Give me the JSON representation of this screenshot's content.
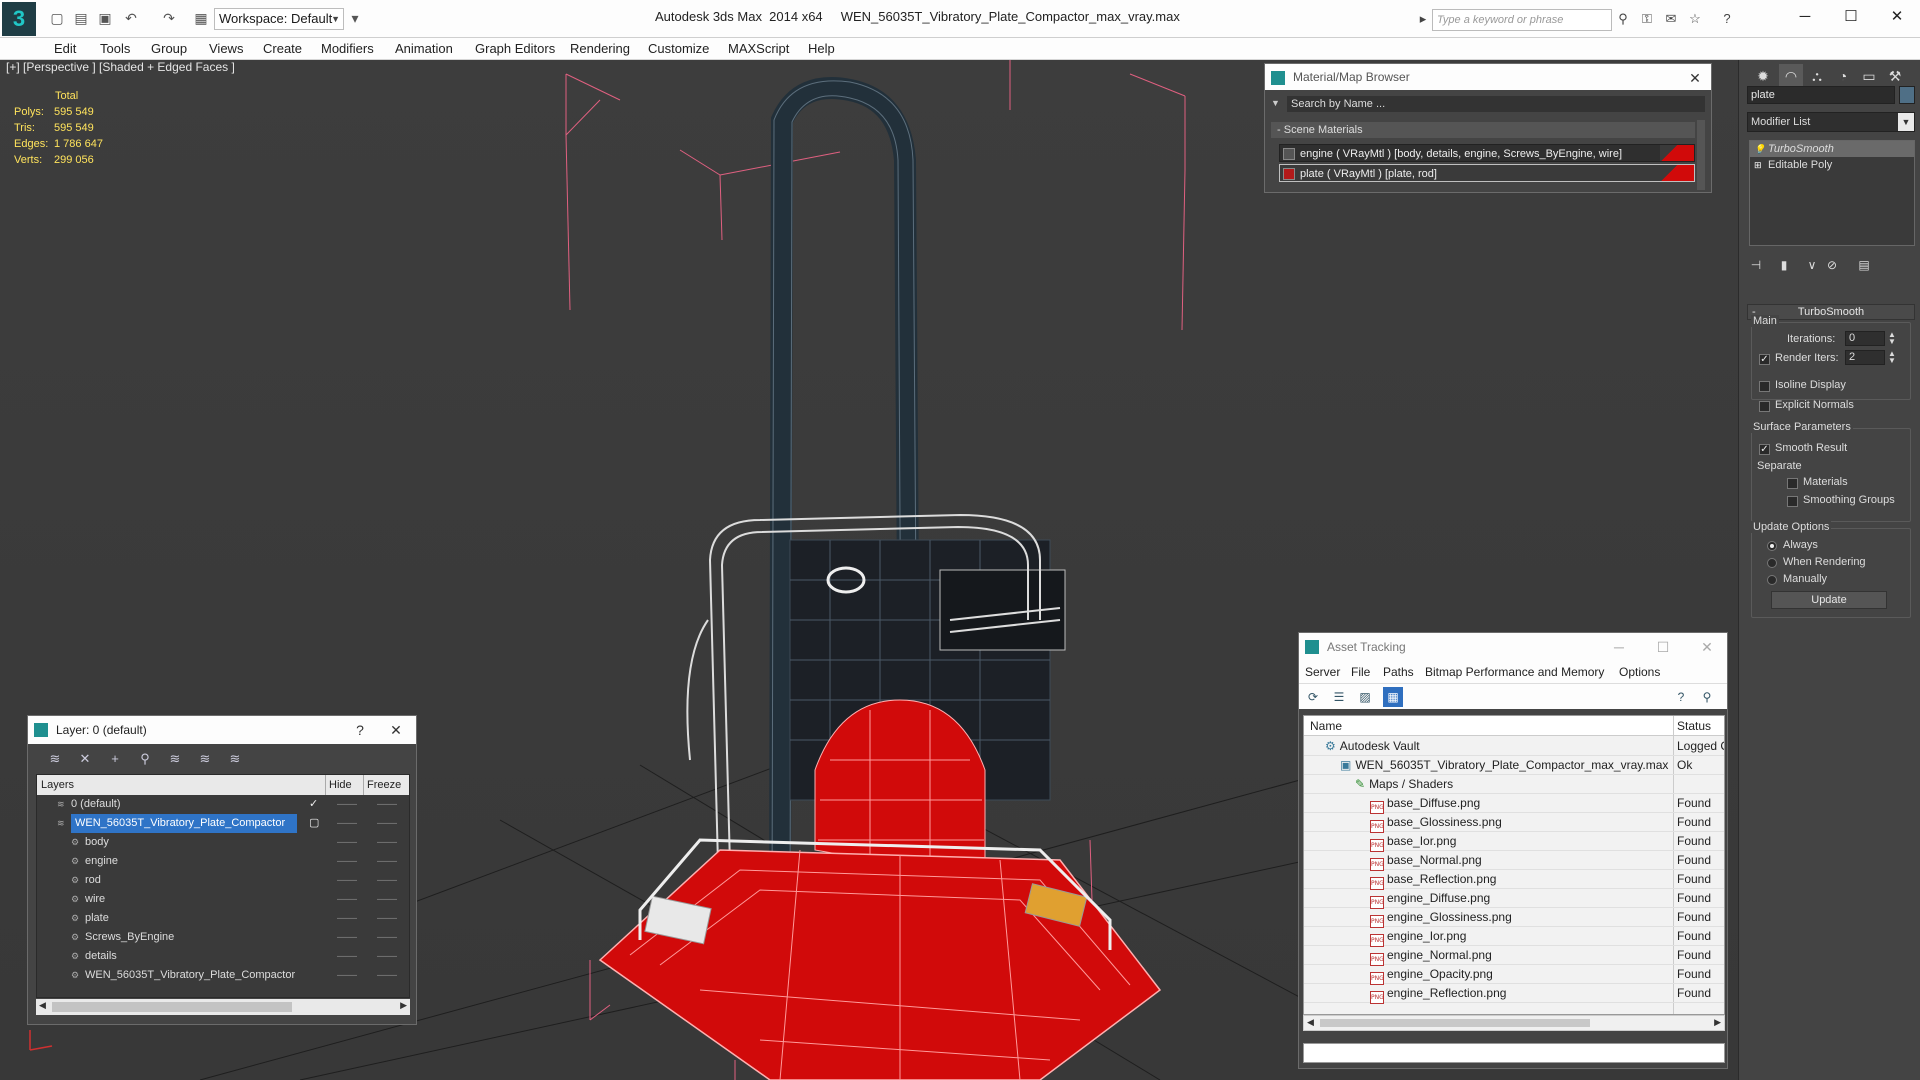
{
  "app": {
    "title": "Autodesk 3ds Max  2014 x64     WEN_56035T_Vibratory_Plate_Compactor_max_vray.max",
    "workspace": "Workspace: Default",
    "search_placeholder": "Type a keyword or phrase"
  },
  "menu": [
    "Edit",
    "Tools",
    "Group",
    "Views",
    "Create",
    "Modifiers",
    "Animation",
    "Graph Editors",
    "Rendering",
    "Customize",
    "MAXScript",
    "Help"
  ],
  "viewport": {
    "label": "[+] [Perspective ] [Shaded + Edged Faces ]",
    "stats_header": "Total",
    "stats": [
      {
        "label": "Polys:",
        "value": "595 549"
      },
      {
        "label": "Tris:",
        "value": "595 549"
      },
      {
        "label": "Edges:",
        "value": "1 786 647"
      },
      {
        "label": "Verts:",
        "value": "299 056"
      }
    ]
  },
  "material_browser": {
    "title": "Material/Map Browser",
    "search_placeholder": "Search by Name ...",
    "section": "Scene Materials",
    "materials": [
      {
        "label": "engine  ( VRayMtl ) [body, details, engine, Screws_ByEngine, wire]"
      },
      {
        "label": "plate  ( VRayMtl ) [plate, rod]"
      }
    ]
  },
  "command_panel": {
    "object_name": "plate",
    "modifier_list": "Modifier List",
    "stack": [
      "TurboSmooth",
      "Editable Poly"
    ],
    "rollout_title": "TurboSmooth",
    "main_group": "Main",
    "iterations_label": "Iterations:",
    "iterations_value": "0",
    "render_iters_label": "Render Iters:",
    "render_iters_value": "2",
    "isoline_label": "Isoline Display",
    "explicit_normals_label": "Explicit Normals",
    "surface_group": "Surface Parameters",
    "smooth_result_label": "Smooth Result",
    "separate_label": "Separate",
    "materials_label": "Materials",
    "smoothing_groups_label": "Smoothing Groups",
    "update_group": "Update Options",
    "always_label": "Always",
    "when_rendering_label": "When Rendering",
    "manually_label": "Manually",
    "update_button": "Update"
  },
  "layer_window": {
    "title": "Layer: 0 (default)",
    "help": "?",
    "columns": {
      "layers": "Layers",
      "hide": "Hide",
      "freeze": "Freeze"
    },
    "rows": [
      {
        "name": "0 (default)",
        "indent": 0
      },
      {
        "name": "WEN_56035T_Vibratory_Plate_Compactor",
        "indent": 0
      },
      {
        "name": "body",
        "indent": 1
      },
      {
        "name": "engine",
        "indent": 1
      },
      {
        "name": "rod",
        "indent": 1
      },
      {
        "name": "wire",
        "indent": 1
      },
      {
        "name": "plate",
        "indent": 1
      },
      {
        "name": "Screws_ByEngine",
        "indent": 1
      },
      {
        "name": "details",
        "indent": 1
      },
      {
        "name": "WEN_56035T_Vibratory_Plate_Compactor",
        "indent": 1
      }
    ]
  },
  "asset_tracking": {
    "title": "Asset Tracking",
    "menu": [
      "Server",
      "File",
      "Paths",
      "Bitmap Performance and Memory",
      "Options"
    ],
    "columns": {
      "name": "Name",
      "status": "Status"
    },
    "rows": [
      {
        "name": "Autodesk Vault",
        "status": "Logged C",
        "indent": 1
      },
      {
        "name": "WEN_56035T_Vibratory_Plate_Compactor_max_vray.max",
        "status": "Ok",
        "indent": 2
      },
      {
        "name": "Maps / Shaders",
        "status": "",
        "indent": 3
      },
      {
        "name": "base_Diffuse.png",
        "status": "Found",
        "indent": 4
      },
      {
        "name": "base_Glossiness.png",
        "status": "Found",
        "indent": 4
      },
      {
        "name": "base_Ior.png",
        "status": "Found",
        "indent": 4
      },
      {
        "name": "base_Normal.png",
        "status": "Found",
        "indent": 4
      },
      {
        "name": "base_Reflection.png",
        "status": "Found",
        "indent": 4
      },
      {
        "name": "engine_Diffuse.png",
        "status": "Found",
        "indent": 4
      },
      {
        "name": "engine_Glossiness.png",
        "status": "Found",
        "indent": 4
      },
      {
        "name": "engine_Ior.png",
        "status": "Found",
        "indent": 4
      },
      {
        "name": "engine_Normal.png",
        "status": "Found",
        "indent": 4
      },
      {
        "name": "engine_Opacity.png",
        "status": "Found",
        "indent": 4
      },
      {
        "name": "engine_Reflection.png",
        "status": "Found",
        "indent": 4
      }
    ]
  },
  "colors": {
    "selection_blue": "#2f74c7",
    "stats_yellow": "#ffe35c",
    "plate_red": "#d10a0a",
    "bbox_pink": "#e06080"
  }
}
